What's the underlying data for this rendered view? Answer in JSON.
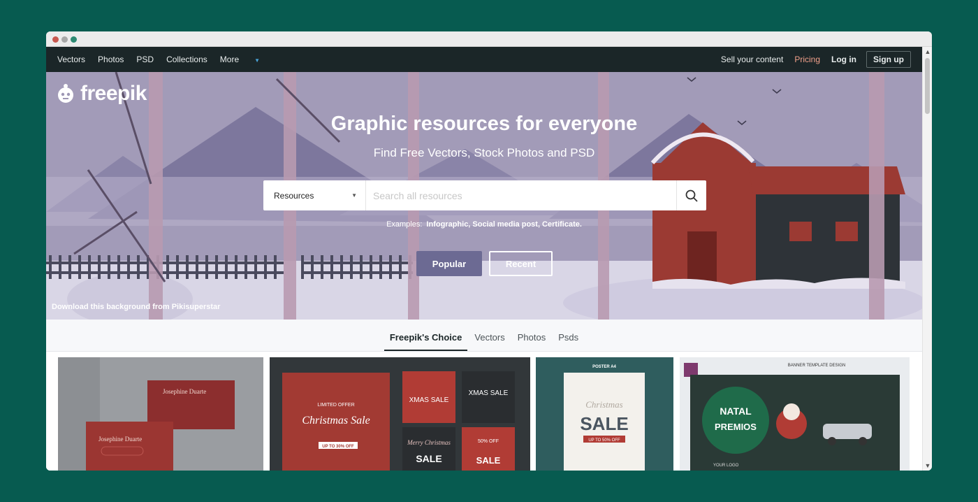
{
  "nav": {
    "left": [
      "Vectors",
      "Photos",
      "PSD",
      "Collections",
      "More"
    ],
    "sell": "Sell your content",
    "pricing": "Pricing",
    "login": "Log in",
    "signup": "Sign up"
  },
  "hero": {
    "logo_text": "freepik",
    "title": "Graphic resources for everyone",
    "subtitle": "Find Free Vectors, Stock Photos and PSD",
    "search": {
      "category": "Resources",
      "placeholder": "Search all resources"
    },
    "examples_label": "Examples:",
    "examples": "Infographic, Social media post, Certificate.",
    "popular": "Popular",
    "recent": "Recent",
    "credit": "Download this background from Pikisuperstar"
  },
  "tabs": [
    "Freepik's Choice",
    "Vectors",
    "Photos",
    "Psds"
  ],
  "cards": {
    "card1": {
      "name_top": "Josephine Duarte",
      "name_bottom": "Josephine Duarte"
    },
    "card2": {
      "left_top": "LIMITED OFFER",
      "left_script": "Christmas Sale",
      "left_bottom": "UP TO 30% OFF",
      "tile1": "XMAS SALE",
      "tile2": "XMAS SALE",
      "tile3_script": "Merry Christmas",
      "tile3": "SALE",
      "tile4_top": "50% OFF",
      "tile4": "SALE"
    },
    "card3": {
      "top": "POSTER A4",
      "script": "Christmas",
      "main": "SALE",
      "sub": "UP TO 50% OFF"
    },
    "card4": {
      "top": "BANNER TEMPLATE DESIGN",
      "badge1": "NATAL",
      "badge2": "PREMIOS",
      "logo": "YOUR LOGO"
    }
  },
  "colors": {
    "page_bg": "#075b50",
    "nav_bg": "#1b2628",
    "pricing": "#f0a08a",
    "hero_bg": "#9e97b4",
    "popular_bg": "#6c6a93",
    "barn_red": "#9b3a33"
  }
}
